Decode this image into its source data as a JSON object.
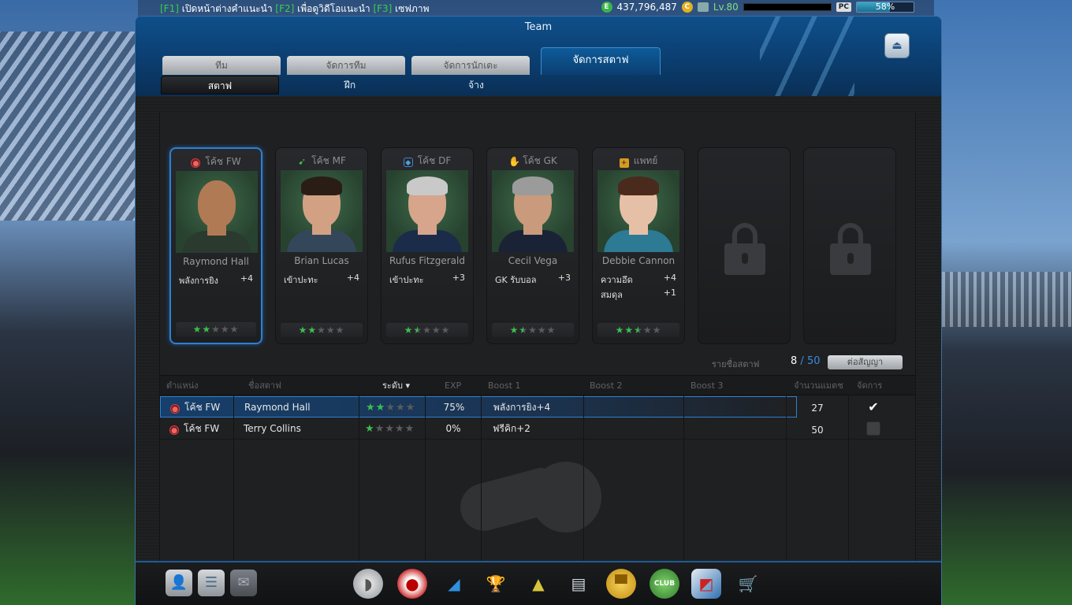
{
  "topbar": {
    "hint_f1_key": "[F1]",
    "hint_f1_text": " เปิดหน้าต่างคำแนะนำ ",
    "hint_f2_key": "[F2]",
    "hint_f2_text": " เพื่อดูวิดีโอแนะนำ ",
    "hint_f3_key": "[F3]",
    "hint_f3_text": " เซฟภาพ",
    "ep_icon": "E",
    "ep_value": "437,796,487",
    "coin_icon": "C",
    "level": "Lv.80",
    "pc_badge": "PC",
    "progress_label": "58%",
    "progress_value": 0.58
  },
  "window": {
    "title": "Team",
    "tabs": [
      "ทีม",
      "จัดการทีม",
      "จัดการนักเตะ",
      "จัดการสตาฟ"
    ],
    "active_tab": "จัดการสตาฟ",
    "subtabs": [
      "สตาฟ",
      "ฝึก",
      "จ้าง"
    ]
  },
  "staff_cards": [
    {
      "role_icon": "ball-icon",
      "role": "โค้ช FW",
      "name": "Raymond Hall",
      "stats": [
        {
          "label": "พลังการยิง",
          "value": "+4"
        }
      ],
      "stars": 2,
      "max_stars": 5,
      "selected": true
    },
    {
      "role_icon": "boot-icon",
      "role": "โค้ช MF",
      "name": "Brian Lucas",
      "stats": [
        {
          "label": "เข้าปะทะ",
          "value": "+4"
        }
      ],
      "stars": 2,
      "max_stars": 5,
      "selected": false
    },
    {
      "role_icon": "shield-icon",
      "role": "โค้ช DF",
      "name": "Rufus Fitzgerald",
      "stats": [
        {
          "label": "เข้าปะทะ",
          "value": "+3"
        }
      ],
      "stars": 1.5,
      "max_stars": 5,
      "selected": false
    },
    {
      "role_icon": "glove-icon",
      "role": "โค้ช GK",
      "name": "Cecil Vega",
      "stats": [
        {
          "label": "GK รับบอล",
          "value": "+3"
        }
      ],
      "stars": 1.5,
      "max_stars": 5,
      "selected": false
    },
    {
      "role_icon": "medkit-icon",
      "role": "แพทย์",
      "name": "Debbie Cannon",
      "stats": [
        {
          "label": "ความอึด",
          "value": "+4"
        },
        {
          "label": "สมดุล",
          "value": "+1"
        }
      ],
      "stars": 2.5,
      "max_stars": 5,
      "selected": false
    }
  ],
  "locked_slots": 2,
  "staff_list": {
    "label": "รายชื่อสตาฟ",
    "count": "8",
    "separator": " / ",
    "max": "50",
    "renew_button": "ต่อสัญญา"
  },
  "table": {
    "headers": [
      "ตำแหน่ง",
      "ชื่อสตาฟ",
      "ระดับ ▾",
      "EXP",
      "Boost 1",
      "Boost 2",
      "Boost 3",
      "จำนวนแมตช",
      "จัดการ"
    ],
    "rows": [
      {
        "position": "โค้ช FW",
        "name": "Raymond Hall",
        "stars": 2,
        "exp": "75%",
        "boost1": "พลังการยิง+4",
        "boost2": "",
        "boost3": "",
        "matches": "27",
        "managed": true,
        "selected": true
      },
      {
        "position": "โค้ช FW",
        "name": "Terry Collins",
        "stars": 1,
        "exp": "0%",
        "boost1": "ฟรีคิก+2",
        "boost2": "",
        "boost3": "",
        "matches": "50",
        "managed": false,
        "selected": false
      }
    ]
  },
  "bottom_toolbar": {
    "left": [
      "profile-icon",
      "chat-icon",
      "mail-icon"
    ],
    "menu": [
      "whistle-icon",
      "ball-icon",
      "boots-icon",
      "trophy-icon",
      "ranking-icon",
      "notepad-icon",
      "shirt-icon",
      "club-icon",
      "card-icon",
      "shop-cart-icon"
    ]
  }
}
